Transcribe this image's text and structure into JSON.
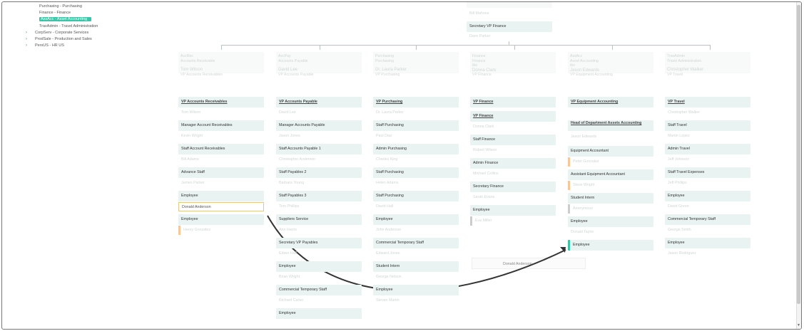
{
  "sidebar": {
    "items": [
      {
        "label": "Purchasing - Purchasing",
        "level": "child",
        "selected": false
      },
      {
        "label": "Finance - Finance",
        "level": "child",
        "selected": false
      },
      {
        "label": "AssAcc - Asset Accounting",
        "level": "child",
        "selected": true
      },
      {
        "label": "TravAdmin - Travel Administration",
        "level": "child",
        "selected": false
      },
      {
        "label": "CorpServ - Corporate Services",
        "level": "parent",
        "selected": false
      },
      {
        "label": "ProdSale - Production and Sales",
        "level": "parent",
        "selected": false
      },
      {
        "label": "PersUS - HR US",
        "level": "parent",
        "selected": false
      }
    ]
  },
  "top": {
    "person1": "Bill Mahone",
    "card": "Secretary VP Finance",
    "person2": "Dave Parker"
  },
  "columns": [
    {
      "head": {
        "org": "AccRec",
        "org_sub": "Accounts Receivable",
        "name": "Tom Wilson",
        "title": "VP Accounts Receivables"
      },
      "rows": [
        {
          "position": "VP Accounts Receivables",
          "link": true,
          "person": "Tom Wilson"
        },
        {
          "position": "Manager Account Receivables",
          "person": "Kevin Wright"
        },
        {
          "position": "Staff Account Receivables",
          "person": "Bill Adams"
        },
        {
          "position": "Advance Staff",
          "person": "James Parker"
        },
        {
          "position": "Employee",
          "person": "Donald Anderson",
          "highlight": true
        },
        {
          "position": "Employee",
          "person": "Henry Gonzalez",
          "bar": "orange"
        }
      ]
    },
    {
      "head": {
        "org": "AccPay",
        "org_sub": "Accounts Payable",
        "name": "David Lee",
        "title": "VP Accounts Payable"
      },
      "rows": [
        {
          "position": "VP Accounts Payable",
          "link": true,
          "person": "David Lee"
        },
        {
          "position": "Manager Accounts Payable",
          "person": "Jason Jones"
        },
        {
          "position": "Staff Accounts Payable 1",
          "person": "Christopher Anderson"
        },
        {
          "position": "Staff Payables 2",
          "person": "Barbara Young"
        },
        {
          "position": "Staff Payables 3",
          "person": "Tom Phillips"
        },
        {
          "position": "Suppliers Service",
          "person": "Ann Harris"
        },
        {
          "position": "Secretary VP Payables",
          "person": "Edwin Hall"
        },
        {
          "position": "Employee",
          "person": "Brian Wright"
        },
        {
          "position": "Commercial Temporary Staff",
          "person": "Richard Carter"
        },
        {
          "position": "Employee",
          "person": ""
        }
      ]
    },
    {
      "head": {
        "org": "Purchasing",
        "org_sub": "Purchasing",
        "name": "Dr. Laura Parker",
        "title": "VP Purchasing"
      },
      "rows": [
        {
          "position": "VP Purchasing",
          "link": true,
          "person": "Dr. Laura Parker"
        },
        {
          "position": "Staff Purchasing",
          "person": "Paul Diaz"
        },
        {
          "position": "Admin Purchasing",
          "person": "Charles King"
        },
        {
          "position": "Staff Purchasing",
          "person": "Helen Adams"
        },
        {
          "position": "Staff Purchasing",
          "person": "David Hall"
        },
        {
          "position": "Employee",
          "person": "John Anderson"
        },
        {
          "position": "Commercial Temporary Staff",
          "person": "Edward Jones"
        },
        {
          "position": "Student Intern",
          "person": "George Nelson"
        },
        {
          "position": "Employee",
          "person": "Steven Martin"
        }
      ]
    },
    {
      "head": {
        "org": "Finance",
        "org_sub": "Finance",
        "name": "Donna Clark",
        "title": "VP Finance",
        "tbs": "tbs"
      },
      "rows": [
        {
          "position": "VP Finance",
          "link": true,
          "person": ""
        },
        {
          "position": "VP Finance",
          "link": true,
          "person": "Donna Clark"
        },
        {
          "position": "Staff Finance",
          "person": "Robert Wilson"
        },
        {
          "position": "Admin Finance",
          "person": "Michael Collins"
        },
        {
          "position": "Secretary Finance",
          "person": "Sarah Evans"
        },
        {
          "position": "Employee",
          "person": "Eva Miller",
          "bar": "grey"
        }
      ]
    },
    {
      "head": {
        "org": "AssAcc",
        "org_sub": "Asset Accounting",
        "name": "Jason Edwards",
        "title": "VP Equipment Accounting",
        "tbs": "tbs"
      },
      "rows": [
        {
          "position": "VP Equipment Accounting",
          "link": true,
          "person": ""
        },
        {
          "position": "Head of Department Assets Accounting",
          "link": true,
          "two_line": true,
          "person": "Jason Edwards"
        },
        {
          "position": "Equipment Accountant",
          "person": "Peter Gonzalez",
          "bar": "orange"
        },
        {
          "position": "Assistant Equipment Accountant",
          "person": "Steve Wright",
          "bar": "orange"
        },
        {
          "position": "Student Intern",
          "person": "Anonymous",
          "bar": "grey"
        },
        {
          "position": "Employee",
          "person": "Donald Taylor"
        },
        {
          "position": "Employee",
          "person": "",
          "bar": "green"
        }
      ]
    },
    {
      "head": {
        "org": "TravAdmin",
        "org_sub": "Travel Administration",
        "name": "Christopher Walker",
        "title": "VP Travel"
      },
      "rows": [
        {
          "position": "VP Travel",
          "link": true,
          "person": "Christopher Walker"
        },
        {
          "position": "Staff Travel",
          "person": "Martin Lopez"
        },
        {
          "position": "Admin Travel",
          "person": "Jeff Johnson"
        },
        {
          "position": "Staff Travel Expenses",
          "person": "Jeff Phillips"
        },
        {
          "position": "Employee",
          "person": "David Green"
        },
        {
          "position": "Commercial Temporary Staff",
          "person": "George Smith"
        },
        {
          "position": "Employee",
          "person": "Jason Rodriguez"
        }
      ]
    }
  ],
  "drag": {
    "label": "Donald Anderson"
  },
  "colors": {
    "accent": "#3cc3a8",
    "card_bg": "#e9f3f1",
    "arrow": "#333333"
  }
}
